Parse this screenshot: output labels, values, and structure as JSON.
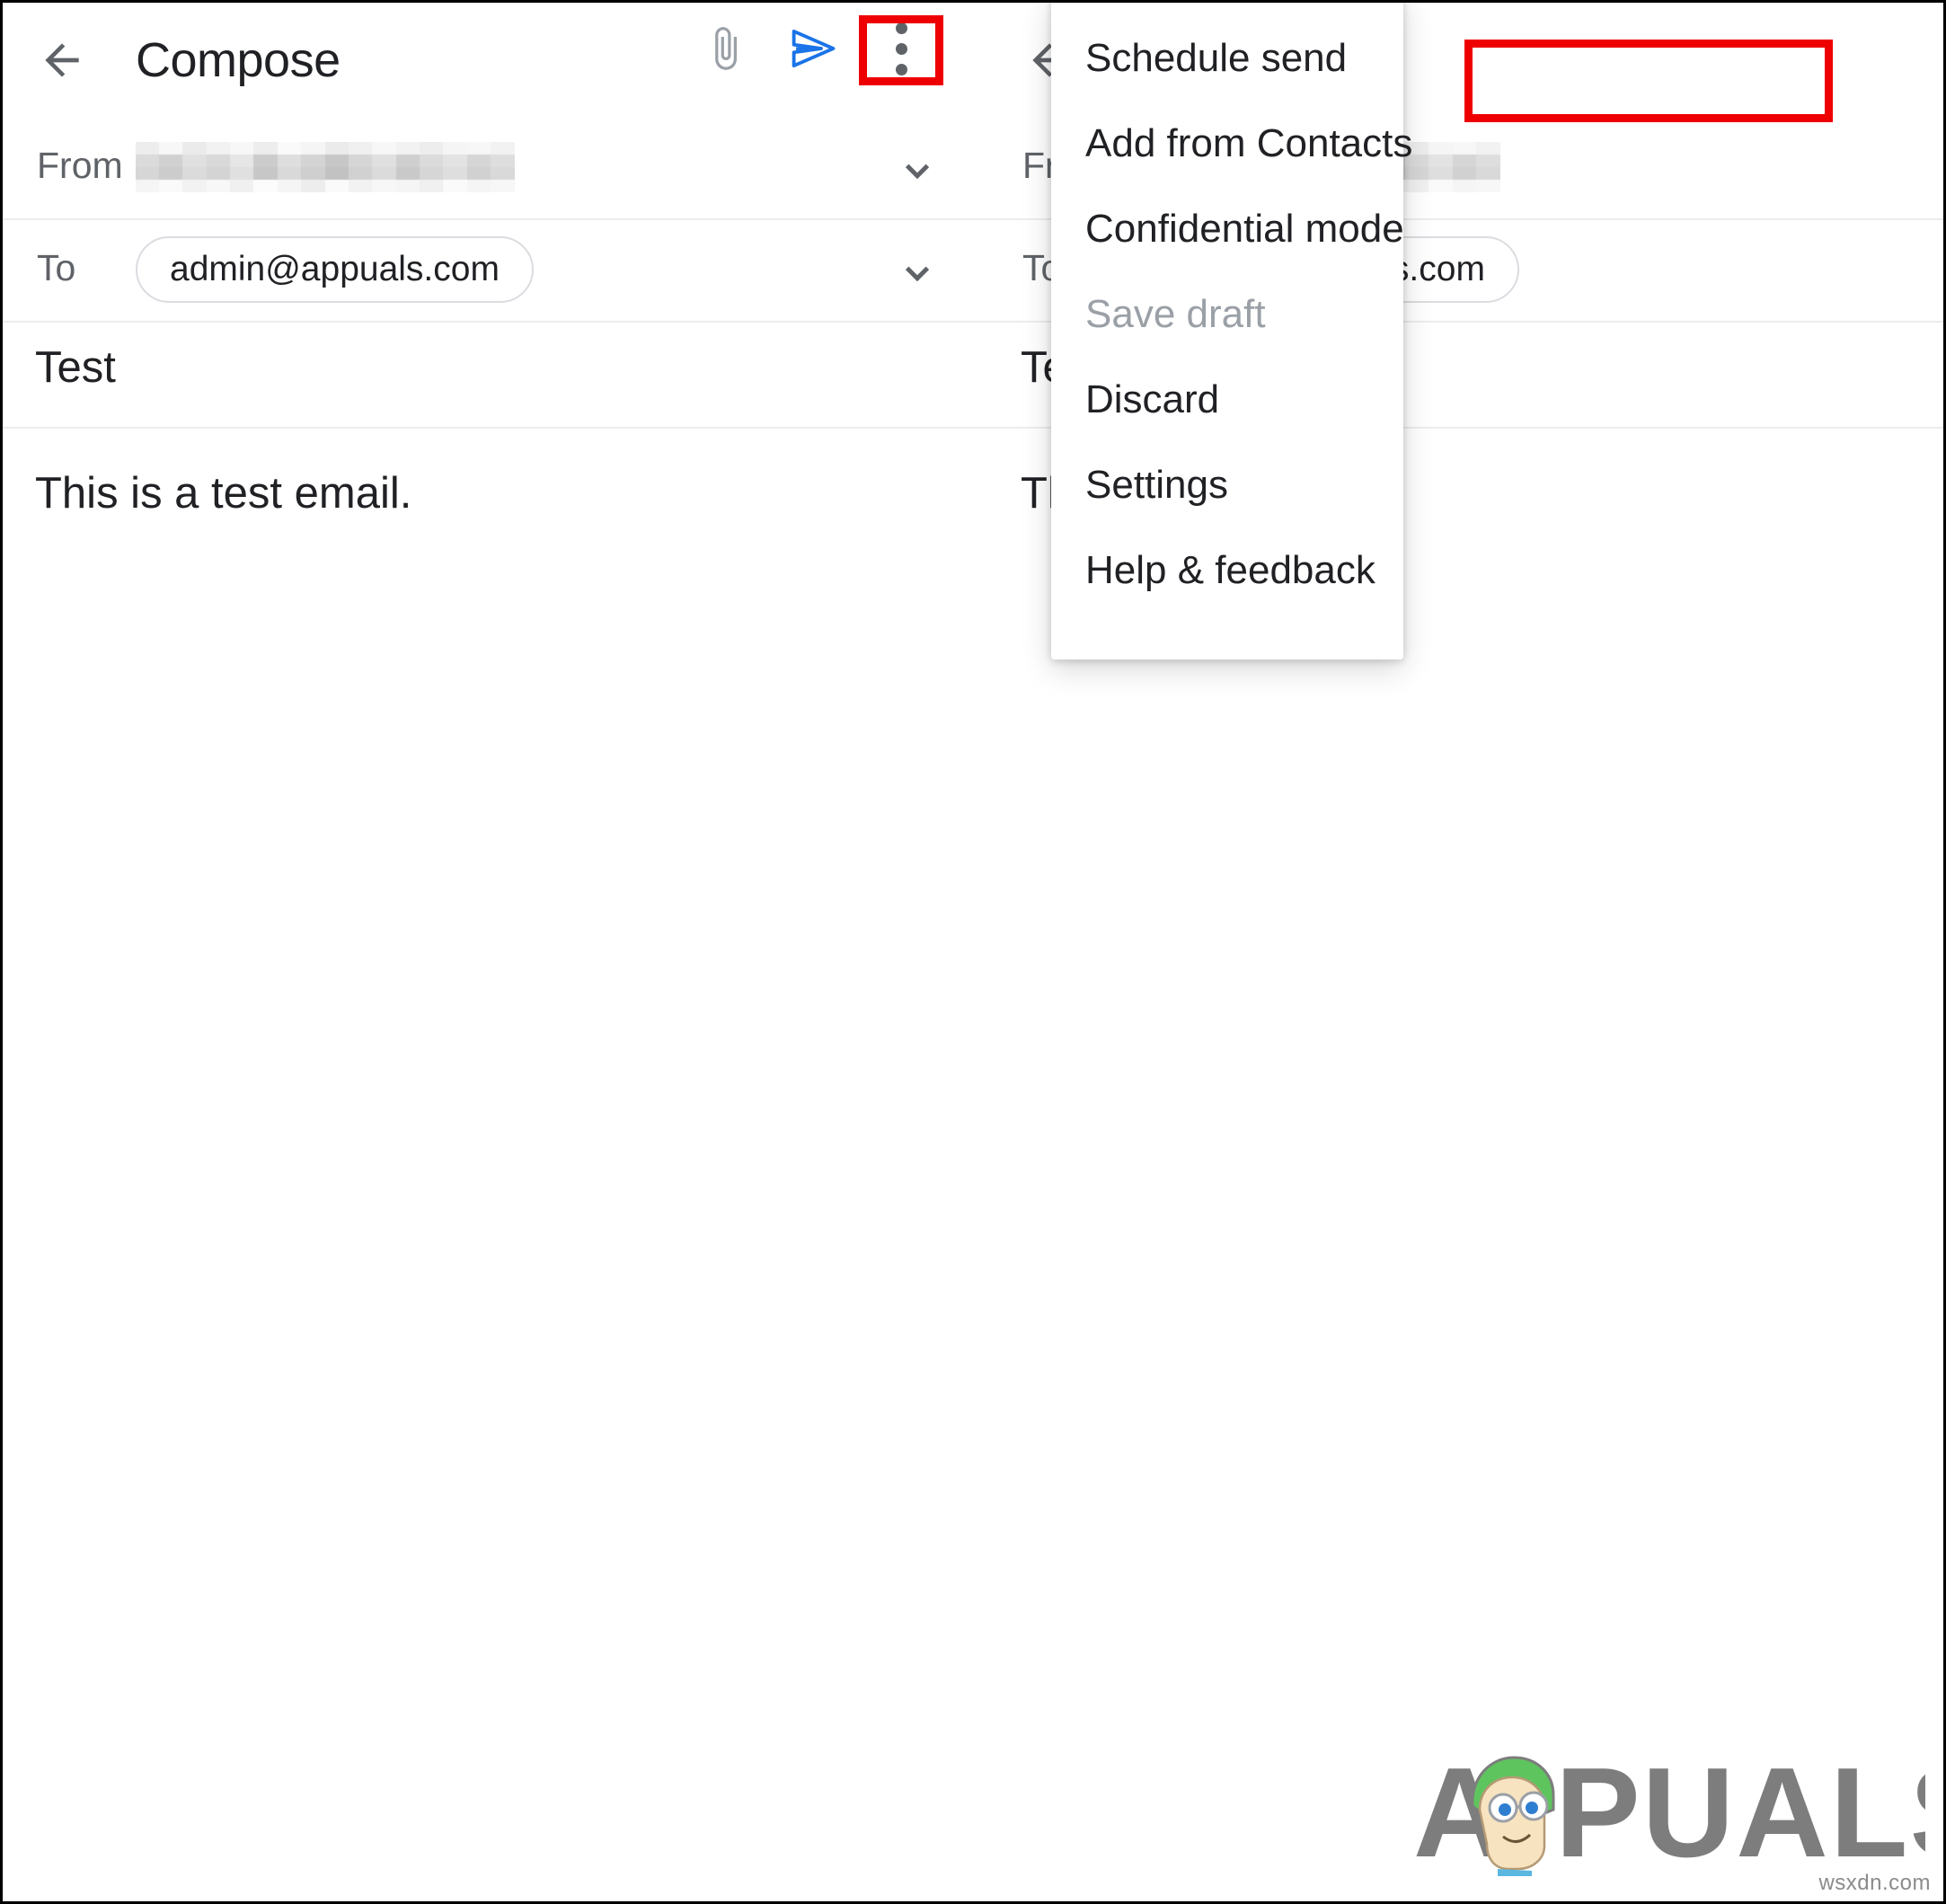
{
  "app": {
    "title": "Compose",
    "brand_logo_text": "PUALS",
    "brand_logo_first_letter": "A",
    "watermark": "wsxdn.com"
  },
  "colors": {
    "annotation_red": "#ee0000",
    "send_blue": "#1a73e8",
    "icon_grey": "#5f6368",
    "text_primary": "#202124",
    "text_disabled": "#9aa0a6",
    "divider": "#ececec",
    "chip_border": "#dadce0",
    "logo_grey": "#7d7d7d",
    "logo_hat_green": "#5ec45e"
  },
  "panels": [
    {
      "id": "left",
      "appbar": {
        "back_icon": "back-arrow-icon",
        "title": "Compose",
        "actions": [
          {
            "name": "attach-icon",
            "label": "Attach file"
          },
          {
            "name": "send-icon",
            "label": "Send"
          },
          {
            "name": "more-options-icon",
            "label": "More options"
          }
        ]
      },
      "fields": {
        "from_label": "From",
        "from_value": "",
        "from_redacted": true,
        "to_label": "To",
        "to_value": "admin@appuals.com",
        "subject": "Test",
        "body": "This is a test email."
      },
      "annotation": {
        "target": "more-options-icon",
        "visible": true
      }
    },
    {
      "id": "right",
      "appbar": {
        "back_icon": "back-arrow-icon",
        "title": "Compose",
        "actions": []
      },
      "fields": {
        "from_label": "From",
        "from_value": "",
        "from_redacted": true,
        "to_label": "To",
        "to_value": "admin@appuals.com",
        "subject": "Test",
        "body": "This is a test email."
      }
    }
  ],
  "overflow_menu": {
    "visible": true,
    "items": [
      {
        "label": "Schedule send",
        "disabled": false,
        "highlighted": true
      },
      {
        "label": "Add from Contacts",
        "disabled": false,
        "highlighted": false
      },
      {
        "label": "Confidential mode",
        "disabled": false,
        "highlighted": false
      },
      {
        "label": "Save draft",
        "disabled": true,
        "highlighted": false
      },
      {
        "label": "Discard",
        "disabled": false,
        "highlighted": false
      },
      {
        "label": "Settings",
        "disabled": false,
        "highlighted": false
      },
      {
        "label": "Help & feedback",
        "disabled": false,
        "highlighted": false
      }
    ]
  }
}
